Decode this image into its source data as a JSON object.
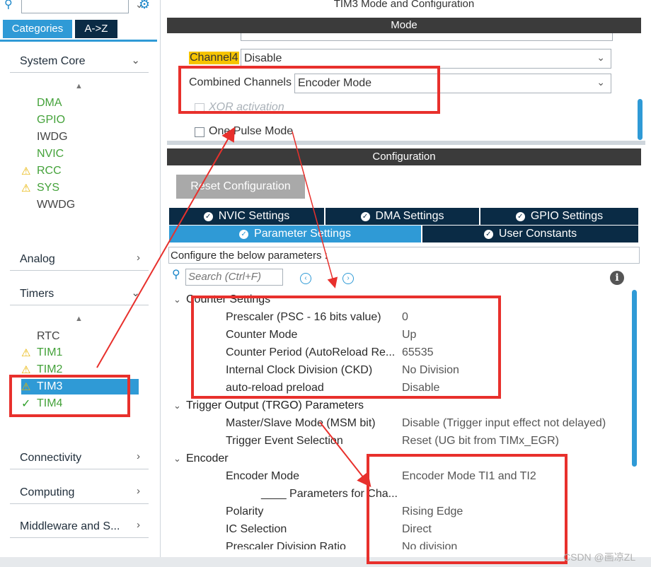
{
  "left": {
    "tabs": {
      "categories": "Categories",
      "az": "A->Z"
    },
    "sections": {
      "system_core": "System Core",
      "analog": "Analog",
      "timers": "Timers",
      "connectivity": "Connectivity",
      "computing": "Computing",
      "middleware": "Middleware and S..."
    },
    "system_core_items": [
      "DMA",
      "GPIO",
      "IWDG",
      "NVIC",
      "RCC",
      "SYS",
      "WWDG"
    ],
    "timer_items": [
      "RTC",
      "TIM1",
      "TIM2",
      "TIM3",
      "TIM4"
    ]
  },
  "right": {
    "title": "TIM3 Mode and Configuration",
    "mode_header": "Mode",
    "channel4": {
      "label": "Channel4",
      "value": "Disable"
    },
    "combined": {
      "label": "Combined Channels",
      "value": "Encoder Mode"
    },
    "xor": "XOR activation",
    "one_pulse": "One Pulse Mode",
    "config_header": "Configuration",
    "reset_button": "Reset Configuration",
    "tabs": {
      "nvic": "NVIC Settings",
      "dma": "DMA Settings",
      "gpio": "GPIO Settings",
      "params": "Parameter Settings",
      "user": "User Constants"
    },
    "configure_note": "Configure the below parameters :",
    "search_placeholder": "Search (Ctrl+F)",
    "groups": {
      "counter": "Counter Settings",
      "trgo": "Trigger Output (TRGO) Parameters",
      "encoder": "Encoder"
    },
    "counter_params": [
      {
        "name": "Prescaler (PSC - 16 bits value)",
        "value": "0"
      },
      {
        "name": "Counter Mode",
        "value": "Up"
      },
      {
        "name": "Counter Period (AutoReload Re...",
        "value": "65535"
      },
      {
        "name": "Internal Clock Division (CKD)",
        "value": "No Division"
      },
      {
        "name": "auto-reload preload",
        "value": "Disable"
      }
    ],
    "trgo_params": [
      {
        "name": "Master/Slave Mode (MSM bit)",
        "value": "Disable (Trigger input effect not delayed)"
      },
      {
        "name": "Trigger Event Selection",
        "value": "Reset (UG bit from TIMx_EGR)"
      }
    ],
    "encoder_params": [
      {
        "name": "Encoder Mode",
        "value": "Encoder Mode TI1 and TI2"
      },
      {
        "name": "____ Parameters for Cha...",
        "value": ""
      },
      {
        "name": "Polarity",
        "value": "Rising Edge"
      },
      {
        "name": "IC Selection",
        "value": "Direct"
      },
      {
        "name": "Prescaler Division Ratio",
        "value": "No division"
      }
    ]
  },
  "watermark": "CSDN @画凉ZL",
  "colors": {
    "accent": "#2f9ad6",
    "dark_tab": "#0a2b45",
    "header_bar": "#3b3b3b",
    "ok_green": "#44a23a",
    "warning": "#e8b400",
    "annotation_red": "#e8302c",
    "channel_highlight": "#f6c400"
  }
}
